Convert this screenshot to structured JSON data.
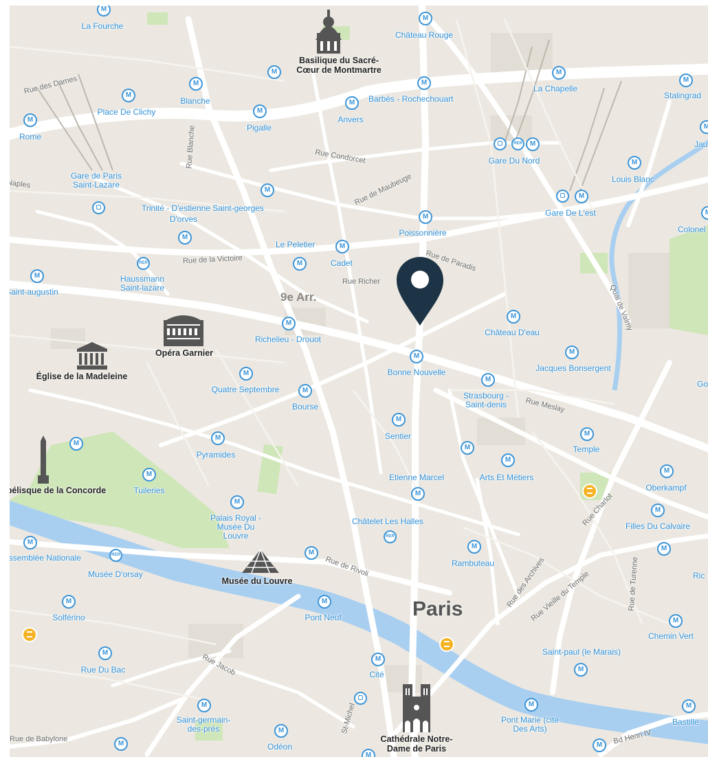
{
  "map": {
    "city_label": "Paris",
    "district_label": "9e Arr.",
    "colors": {
      "land": "#ece8e1",
      "park": "#cfe6b8",
      "water": "#a9cff0",
      "road": "#ffffff",
      "metro": "#3d95d8",
      "pin": "#1d3446",
      "museum": "#f5b324"
    },
    "pin": {
      "icon": "map-pin-icon"
    },
    "stations": [
      "La Fourche",
      "Château Rouge",
      "Blanche",
      "Place De Clichy",
      "Pigalle",
      "Anvers",
      "Barbès - Rochechouart",
      "La Chapelle",
      "Stalingrad",
      "Rome",
      "Gare Du Nord",
      "Louis Blanc",
      "Gare de Paris Saint-Lazare",
      "Trinité - D'estienne Saint-georges",
      "D'orves",
      "Gare De L'est",
      "Poissonnière",
      "Le Peletier",
      "Cadet",
      "Colonel",
      "Haussmann Saint-lazare",
      "Saint-augustin",
      "Richelieu - Drouot",
      "Château D'eau",
      "Bonne Nouvelle",
      "Jacques Bonsergent",
      "Quatre Septembre",
      "Bourse",
      "Strasbourg - Saint-denis",
      "Sentier",
      "Temple",
      "Pyramides",
      "Tuileries",
      "Etienne Marcel",
      "Arts Et Métiers",
      "Oberkampf",
      "Palais Royal - Musée Du Louvre",
      "Filles Du Calvaire",
      "Châtelet Les Halles",
      "Assemblée Nationale",
      "Musée D'orsay",
      "Rambuteau",
      "Solférino",
      "Pont Neuf",
      "Chemin Vert",
      "Rue Du Bac",
      "Saint-paul (le Marais)",
      "Cité",
      "Saint-germain-des-prés",
      "Odéon",
      "Pont Marie (cité Des Arts)",
      "Bastille"
    ],
    "streets": [
      "Rue des Dames",
      "Rue Blanche",
      "Rue Condorcet",
      "Rue de Maubeuge",
      "Rue de la Victoire",
      "Rue Richer",
      "Rue de Paradis",
      "Quai de Valmy",
      "Rue Meslay",
      "Rue Charlot",
      "Rue des Archives",
      "Rue de Rivoli",
      "Rue Vieille du Temple",
      "Rue de Turenne",
      "Rue Jacob",
      "Bd Henri IV",
      "Rue de Babylone",
      "Naples",
      "St-Michel"
    ],
    "landmarks": [
      {
        "label": "Basilique du Sacré-Cœur de Montmartre",
        "icon": "basilica-icon"
      },
      {
        "label": "Opéra Garnier",
        "icon": "opera-house-icon"
      },
      {
        "label": "Église de la Madeleine",
        "icon": "church-icon"
      },
      {
        "label": "Obélisque de la Concorde",
        "icon": "obelisk-icon"
      },
      {
        "label": "Musée du Louvre",
        "icon": "pyramid-icon"
      },
      {
        "label": "Cathédrale Notre-Dame de Paris",
        "icon": "cathedral-icon"
      }
    ],
    "partial_labels": [
      "Jau",
      "Go",
      "Ric"
    ]
  }
}
